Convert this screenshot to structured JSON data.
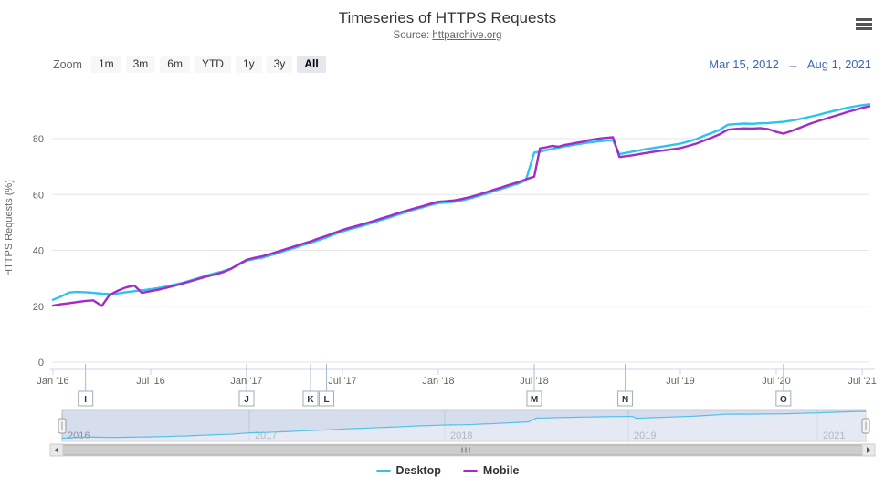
{
  "header": {
    "title": "Timeseries of HTTPS Requests",
    "subtitle_prefix": "Source: ",
    "subtitle_link": "httparchive.org"
  },
  "range_selector": {
    "zoom_label": "Zoom",
    "buttons": [
      "1m",
      "3m",
      "6m",
      "YTD",
      "1y",
      "3y",
      "All"
    ],
    "selected": "All",
    "date_from": "Mar 15, 2012",
    "date_arrow": "→",
    "date_to": "Aug 1, 2021"
  },
  "colors": {
    "desktop": "#2dc3ef",
    "mobile": "#a42bc7",
    "grid": "#e6e6e6",
    "axis_line": "#ccd6eb",
    "axis_text": "#666666",
    "flag_border": "#9ab0bd",
    "navigator_mask": "#6685c2",
    "navigator_year_text": "#8a93a3",
    "scrollbar_thumb": "#cdcdcd"
  },
  "chart_data": {
    "type": "line",
    "title": "Timeseries of HTTPS Requests",
    "subtitle": "Source: httparchive.org",
    "ylabel": "HTTPS Requests (%)",
    "ylim": [
      0,
      100
    ],
    "yticks": [
      0,
      20,
      40,
      60,
      80
    ],
    "grid": "horizontal",
    "legend_position": "bottom",
    "xticks": [
      {
        "label": "Jan '16",
        "date": "2016-01-01"
      },
      {
        "label": "Jul '16",
        "date": "2016-07-01"
      },
      {
        "label": "Jan '17",
        "date": "2017-01-01"
      },
      {
        "label": "Jul '17",
        "date": "2017-07-01"
      },
      {
        "label": "Jan '18",
        "date": "2018-01-01"
      },
      {
        "label": "Jul '18",
        "date": "2018-07-01"
      },
      {
        "label": "Jul '19",
        "date": "2019-07-01"
      },
      {
        "label": "Jul '20",
        "date": "2020-07-01"
      },
      {
        "label": "Jul '21",
        "date": "2021-07-01"
      }
    ],
    "flags": [
      {
        "label": "I",
        "date": "2016-03-01"
      },
      {
        "label": "J",
        "date": "2017-01-01"
      },
      {
        "label": "K",
        "date": "2017-05-01"
      },
      {
        "label": "L",
        "date": "2017-06-01"
      },
      {
        "label": "M",
        "date": "2018-07-01"
      },
      {
        "label": "N",
        "date": "2019-02-15"
      },
      {
        "label": "O",
        "date": "2020-08-01"
      }
    ],
    "series": [
      {
        "name": "Desktop",
        "color": "#2dc3ef",
        "points": [
          [
            "2016-01-01",
            22.3
          ],
          [
            "2016-01-15",
            23.4
          ],
          [
            "2016-02-01",
            24.9
          ],
          [
            "2016-02-15",
            25.1
          ],
          [
            "2016-03-01",
            25.0
          ],
          [
            "2016-03-15",
            24.8
          ],
          [
            "2016-04-01",
            24.5
          ],
          [
            "2016-04-15",
            24.4
          ],
          [
            "2016-05-01",
            24.6
          ],
          [
            "2016-05-15",
            25.0
          ],
          [
            "2016-06-01",
            25.4
          ],
          [
            "2016-06-15",
            25.7
          ],
          [
            "2016-07-01",
            26.1
          ],
          [
            "2016-07-15",
            26.5
          ],
          [
            "2016-08-01",
            27.1
          ],
          [
            "2016-08-15",
            27.7
          ],
          [
            "2016-09-01",
            28.4
          ],
          [
            "2016-09-15",
            29.2
          ],
          [
            "2016-10-01",
            30.1
          ],
          [
            "2016-10-15",
            30.9
          ],
          [
            "2016-11-01",
            31.8
          ],
          [
            "2016-11-15",
            32.4
          ],
          [
            "2016-12-01",
            33.4
          ],
          [
            "2016-12-15",
            34.7
          ],
          [
            "2017-01-01",
            36.3
          ],
          [
            "2017-01-15",
            36.9
          ],
          [
            "2017-02-01",
            37.4
          ],
          [
            "2017-02-15",
            38.2
          ],
          [
            "2017-03-01",
            39.1
          ],
          [
            "2017-03-15",
            40.0
          ],
          [
            "2017-04-01",
            40.9
          ],
          [
            "2017-04-15",
            41.8
          ],
          [
            "2017-05-01",
            42.7
          ],
          [
            "2017-05-15",
            43.6
          ],
          [
            "2017-06-01",
            44.6
          ],
          [
            "2017-06-15",
            45.7
          ],
          [
            "2017-07-01",
            46.8
          ],
          [
            "2017-07-15",
            47.6
          ],
          [
            "2017-08-01",
            48.4
          ],
          [
            "2017-08-15",
            49.2
          ],
          [
            "2017-09-01",
            50.1
          ],
          [
            "2017-09-15",
            51.0
          ],
          [
            "2017-10-01",
            51.9
          ],
          [
            "2017-10-15",
            52.8
          ],
          [
            "2017-11-01",
            53.7
          ],
          [
            "2017-11-15",
            54.6
          ],
          [
            "2017-12-01",
            55.4
          ],
          [
            "2017-12-15",
            56.2
          ],
          [
            "2018-01-01",
            56.9
          ],
          [
            "2018-01-15",
            57.1
          ],
          [
            "2018-02-01",
            57.4
          ],
          [
            "2018-02-15",
            57.9
          ],
          [
            "2018-03-01",
            58.6
          ],
          [
            "2018-03-15",
            59.4
          ],
          [
            "2018-04-01",
            60.3
          ],
          [
            "2018-04-15",
            61.2
          ],
          [
            "2018-05-01",
            62.1
          ],
          [
            "2018-05-15",
            63.0
          ],
          [
            "2018-06-01",
            63.9
          ],
          [
            "2018-06-15",
            65.0
          ],
          [
            "2018-07-01",
            75.0
          ],
          [
            "2018-07-15",
            75.3
          ],
          [
            "2018-08-01",
            75.9
          ],
          [
            "2018-08-15",
            76.3
          ],
          [
            "2018-09-01",
            76.8
          ],
          [
            "2018-09-15",
            77.2
          ],
          [
            "2018-10-01",
            77.6
          ],
          [
            "2018-10-15",
            77.9
          ],
          [
            "2018-11-01",
            78.3
          ],
          [
            "2018-11-15",
            78.6
          ],
          [
            "2018-12-01",
            78.9
          ],
          [
            "2018-12-15",
            79.1
          ],
          [
            "2019-01-01",
            79.3
          ],
          [
            "2019-01-15",
            79.4
          ],
          [
            "2019-02-01",
            74.4
          ],
          [
            "2019-03-01",
            75.3
          ],
          [
            "2019-04-01",
            76.1
          ],
          [
            "2019-05-01",
            76.8
          ],
          [
            "2019-06-01",
            77.5
          ],
          [
            "2019-07-01",
            78.2
          ],
          [
            "2019-08-01",
            79.0
          ],
          [
            "2019-09-01",
            79.8
          ],
          [
            "2019-10-01",
            81.0
          ],
          [
            "2019-11-01",
            82.1
          ],
          [
            "2019-12-01",
            83.2
          ],
          [
            "2020-01-01",
            85.0
          ],
          [
            "2020-02-01",
            85.2
          ],
          [
            "2020-03-01",
            85.4
          ],
          [
            "2020-04-01",
            85.3
          ],
          [
            "2020-05-01",
            85.5
          ],
          [
            "2020-06-01",
            85.6
          ],
          [
            "2020-07-01",
            85.8
          ],
          [
            "2020-08-01",
            86.0
          ],
          [
            "2020-09-01",
            86.4
          ],
          [
            "2020-10-01",
            86.9
          ],
          [
            "2020-11-01",
            87.4
          ],
          [
            "2020-12-01",
            88.0
          ],
          [
            "2021-01-01",
            88.6
          ],
          [
            "2021-02-01",
            89.3
          ],
          [
            "2021-03-01",
            89.9
          ],
          [
            "2021-04-01",
            90.5
          ],
          [
            "2021-05-01",
            91.1
          ],
          [
            "2021-06-01",
            91.6
          ],
          [
            "2021-07-01",
            92.0
          ],
          [
            "2021-08-01",
            92.3
          ]
        ]
      },
      {
        "name": "Mobile",
        "color": "#a42bc7",
        "points": [
          [
            "2016-01-01",
            20.2
          ],
          [
            "2016-01-15",
            20.7
          ],
          [
            "2016-02-01",
            21.1
          ],
          [
            "2016-02-15",
            21.5
          ],
          [
            "2016-03-01",
            21.9
          ],
          [
            "2016-03-15",
            22.1
          ],
          [
            "2016-04-01",
            20.1
          ],
          [
            "2016-04-15",
            24.0
          ],
          [
            "2016-05-01",
            25.6
          ],
          [
            "2016-05-15",
            26.7
          ],
          [
            "2016-06-01",
            27.4
          ],
          [
            "2016-06-15",
            24.8
          ],
          [
            "2016-07-01",
            25.4
          ],
          [
            "2016-07-15",
            25.9
          ],
          [
            "2016-08-01",
            26.6
          ],
          [
            "2016-08-15",
            27.3
          ],
          [
            "2016-09-01",
            28.1
          ],
          [
            "2016-09-15",
            28.9
          ],
          [
            "2016-10-01",
            29.8
          ],
          [
            "2016-10-15",
            30.6
          ],
          [
            "2016-11-01",
            31.3
          ],
          [
            "2016-11-15",
            32.1
          ],
          [
            "2016-12-01",
            33.3
          ],
          [
            "2016-12-15",
            34.9
          ],
          [
            "2017-01-01",
            36.6
          ],
          [
            "2017-01-15",
            37.3
          ],
          [
            "2017-02-01",
            37.9
          ],
          [
            "2017-02-15",
            38.7
          ],
          [
            "2017-03-01",
            39.6
          ],
          [
            "2017-03-15",
            40.5
          ],
          [
            "2017-04-01",
            41.4
          ],
          [
            "2017-04-15",
            42.3
          ],
          [
            "2017-05-01",
            43.2
          ],
          [
            "2017-05-15",
            44.2
          ],
          [
            "2017-06-01",
            45.2
          ],
          [
            "2017-06-15",
            46.2
          ],
          [
            "2017-07-01",
            47.3
          ],
          [
            "2017-07-15",
            48.1
          ],
          [
            "2017-08-01",
            48.9
          ],
          [
            "2017-08-15",
            49.7
          ],
          [
            "2017-09-01",
            50.6
          ],
          [
            "2017-09-15",
            51.5
          ],
          [
            "2017-10-01",
            52.4
          ],
          [
            "2017-10-15",
            53.3
          ],
          [
            "2017-11-01",
            54.2
          ],
          [
            "2017-11-15",
            55.0
          ],
          [
            "2017-12-01",
            55.8
          ],
          [
            "2017-12-15",
            56.6
          ],
          [
            "2018-01-01",
            57.4
          ],
          [
            "2018-01-15",
            57.6
          ],
          [
            "2018-02-01",
            57.9
          ],
          [
            "2018-02-15",
            58.4
          ],
          [
            "2018-03-01",
            59.1
          ],
          [
            "2018-03-15",
            59.9
          ],
          [
            "2018-04-01",
            60.8
          ],
          [
            "2018-04-15",
            61.7
          ],
          [
            "2018-05-01",
            62.6
          ],
          [
            "2018-05-15",
            63.5
          ],
          [
            "2018-06-01",
            64.4
          ],
          [
            "2018-06-15",
            65.4
          ],
          [
            "2018-07-01",
            66.4
          ],
          [
            "2018-07-15",
            76.5
          ],
          [
            "2018-08-01",
            76.9
          ],
          [
            "2018-08-15",
            77.4
          ],
          [
            "2018-09-01",
            77.1
          ],
          [
            "2018-09-15",
            77.7
          ],
          [
            "2018-10-01",
            78.1
          ],
          [
            "2018-10-15",
            78.5
          ],
          [
            "2018-11-01",
            78.9
          ],
          [
            "2018-11-15",
            79.4
          ],
          [
            "2018-12-01",
            79.8
          ],
          [
            "2018-12-15",
            80.1
          ],
          [
            "2019-01-01",
            80.3
          ],
          [
            "2019-01-15",
            80.5
          ],
          [
            "2019-02-01",
            73.4
          ],
          [
            "2019-03-01",
            74.0
          ],
          [
            "2019-04-01",
            74.7
          ],
          [
            "2019-05-01",
            75.4
          ],
          [
            "2019-06-01",
            76.0
          ],
          [
            "2019-07-01",
            76.6
          ],
          [
            "2019-08-01",
            77.4
          ],
          [
            "2019-09-01",
            78.2
          ],
          [
            "2019-10-01",
            79.3
          ],
          [
            "2019-11-01",
            80.4
          ],
          [
            "2019-12-01",
            81.6
          ],
          [
            "2020-01-01",
            83.2
          ],
          [
            "2020-02-01",
            83.5
          ],
          [
            "2020-03-01",
            83.7
          ],
          [
            "2020-04-01",
            83.6
          ],
          [
            "2020-05-01",
            83.8
          ],
          [
            "2020-06-01",
            83.4
          ],
          [
            "2020-07-01",
            82.4
          ],
          [
            "2020-08-01",
            81.8
          ],
          [
            "2020-09-01",
            82.6
          ],
          [
            "2020-10-01",
            83.6
          ],
          [
            "2020-11-01",
            84.6
          ],
          [
            "2020-12-01",
            85.6
          ],
          [
            "2021-01-01",
            86.4
          ],
          [
            "2021-02-01",
            87.2
          ],
          [
            "2021-03-01",
            88.0
          ],
          [
            "2021-04-01",
            88.8
          ],
          [
            "2021-05-01",
            89.6
          ],
          [
            "2021-06-01",
            90.3
          ],
          [
            "2021-07-01",
            91.0
          ],
          [
            "2021-08-01",
            91.6
          ]
        ]
      }
    ],
    "navigator": {
      "labels": [
        {
          "label": "2016",
          "date": "2016-01-01"
        },
        {
          "label": "2017",
          "date": "2017-01-01"
        },
        {
          "label": "2018",
          "date": "2018-01-01"
        },
        {
          "label": "2019",
          "date": "2019-01-01"
        },
        {
          "label": "2021",
          "date": "2021-01-01"
        }
      ]
    }
  }
}
